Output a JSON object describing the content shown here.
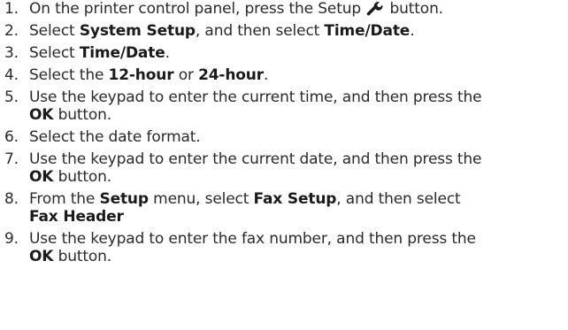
{
  "steps": [
    {
      "number": "1.",
      "parts": [
        "On the printer control panel, press the Setup",
        "button."
      ],
      "icon": "wrench-icon"
    },
    {
      "number": "2.",
      "parts": [
        "Select ",
        "System Setup",
        ", and then select ",
        "Time/Date",
        "."
      ]
    },
    {
      "number": "3.",
      "parts": [
        "Select ",
        "Time/Date",
        "."
      ]
    },
    {
      "number": "4.",
      "parts": [
        "Select the ",
        "12-hour",
        " or ",
        "24-hour",
        "."
      ]
    },
    {
      "number": "5.",
      "parts": [
        "Use the keypad to enter the current time, and then press the",
        "OK",
        " button."
      ]
    },
    {
      "number": "6.",
      "parts": [
        "Select the date format."
      ]
    },
    {
      "number": "7.",
      "parts": [
        "Use the keypad to enter the current date, and then press the",
        "OK",
        " button."
      ]
    },
    {
      "number": "8.",
      "parts": [
        "From the ",
        "Setup",
        " menu, select ",
        "Fax Setup",
        ", and then select",
        "Fax Header"
      ]
    },
    {
      "number": "9.",
      "parts": [
        "Use the keypad to enter the fax number, and then press the",
        "OK",
        " button."
      ]
    }
  ]
}
